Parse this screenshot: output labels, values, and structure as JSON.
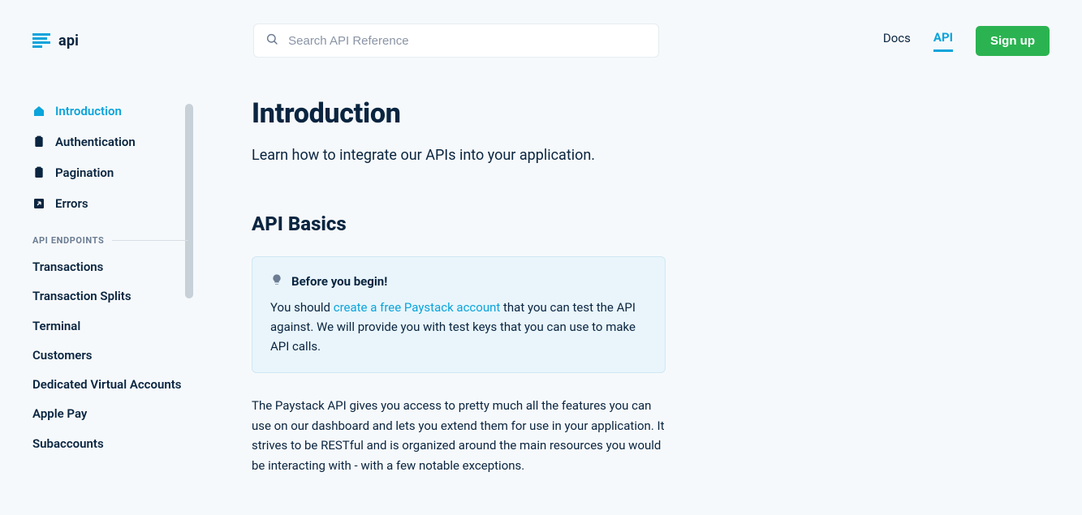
{
  "header": {
    "logo_text": "api",
    "search_placeholder": "Search API Reference",
    "nav": {
      "docs": "Docs",
      "api": "API"
    },
    "signup": "Sign up"
  },
  "sidebar": {
    "main": [
      {
        "label": "Introduction",
        "active": true
      },
      {
        "label": "Authentication",
        "active": false
      },
      {
        "label": "Pagination",
        "active": false
      },
      {
        "label": "Errors",
        "active": false
      }
    ],
    "section_header": "API ENDPOINTS",
    "endpoints": [
      "Transactions",
      "Transaction Splits",
      "Terminal",
      "Customers",
      "Dedicated Virtual Accounts",
      "Apple Pay",
      "Subaccounts"
    ]
  },
  "content": {
    "title": "Introduction",
    "lead": "Learn how to integrate our APIs into your application.",
    "basics_heading": "API Basics",
    "callout": {
      "title": "Before you begin!",
      "body_pre": "You should ",
      "link_text": "create a free Paystack account",
      "body_post": " that you can test the API against. We will provide you with test keys that you can use to make API calls."
    },
    "paragraph": "The Paystack API gives you access to pretty much all the features you can use on our dashboard and lets you extend them for use in your application. It strives to be RESTful and is organized around the main resources you would be interacting with - with a few notable exceptions."
  }
}
